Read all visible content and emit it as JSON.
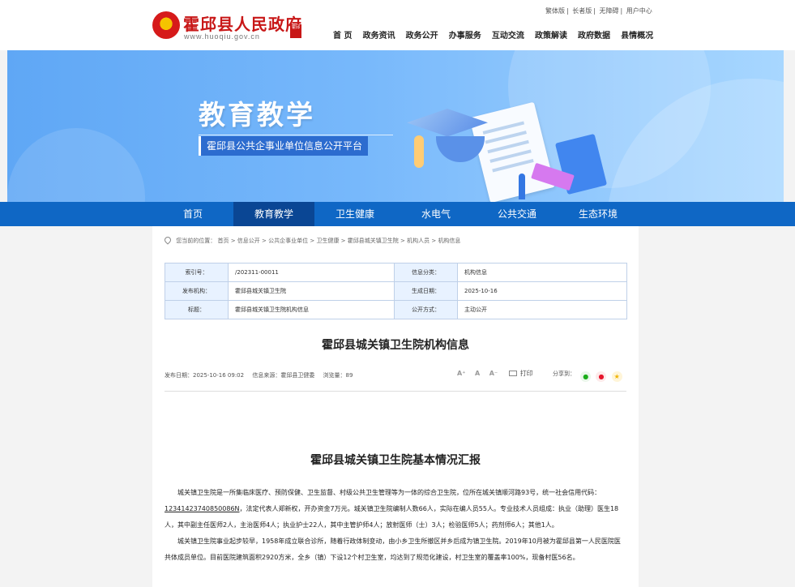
{
  "header": {
    "site_title": "霍邱县人民政府",
    "url_text": "www.huoqiu.gov.cn",
    "seal_text": "霍邱",
    "top_links": [
      "繁体版",
      "长者版",
      "无障碍",
      "用户中心"
    ],
    "nav": [
      "首 页",
      "政务资讯",
      "政务公开",
      "办事服务",
      "互动交流",
      "政策解读",
      "政府数据",
      "县情概况"
    ]
  },
  "banner": {
    "title": "教育教学",
    "subtitle": "霍邱县公共企事业单位信息公开平台"
  },
  "category_nav": {
    "items": [
      "首页",
      "教育教学",
      "卫生健康",
      "水电气",
      "公共交通",
      "生态环境"
    ],
    "active": "教育教学"
  },
  "breadcrumb": {
    "prefix": "您当前的位置：",
    "items": [
      "首页",
      "信息公开",
      "公共企事业单位",
      "卫生健康",
      "霍邱县城关镇卫生院",
      "机构人员",
      "机构信息"
    ]
  },
  "meta": {
    "rows": [
      [
        "索引号：",
        "/202311-00011",
        "信息分类：",
        "机构信息"
      ],
      [
        "发布机构：",
        "霍邱县城关镇卫生院",
        "生成日期：",
        "2025-10-16"
      ],
      [
        "标题：",
        "霍邱县城关镇卫生院机构信息",
        "公开方式：",
        "主动公开"
      ]
    ]
  },
  "article": {
    "title": "霍邱县城关镇卫生院机构信息",
    "publish_date": "发布日期：2025-10-16 09:02",
    "source": "信息来源：霍邱县卫健委",
    "views": "浏览量：89",
    "font_large": "A⁺",
    "font_medium": "A",
    "font_small": "A⁻",
    "print_label": "打印",
    "share_label": "分享到：",
    "section_title": "霍邱县城关镇卫生院基本情况汇报",
    "para1_before_code": "城关镇卫生院是一所集临床医疗、预防保健、卫生监督、村级公共卫生管理等为一体的综合卫生院，位所在城关镇顺河路93号，统一社会信用代码：",
    "credit_code": "12341423740850086N",
    "para1_after_code": "，法定代表人郑新权，开办资金7万元。城关镇卫生院编制人数66人，实际在编人员55人。专业技术人员组成：执业（助理）医生18人，其中副主任医师2人，主治医师4人；执业护士22人，其中主管护师4人；放射医师（士）3人；检验医师5人；药剂师6人；其他1人。",
    "para2": "城关镇卫生院事业起步较早，1958年成立联合诊所，随着行政体制变动，由小乡卫生所撤区并乡后成为镇卫生院。2019年10月被为霍邱县第一人民医院医共体成员单位。目前医院建筑面积2920方米，全乡（镇）下设12个村卫生室，均达到了规范化建设，村卫生室的覆盖率100%，现备村医56名。"
  },
  "colors": {
    "brand_red": "#c81717",
    "nav_blue": "#0f67c5",
    "nav_active": "#0a4694",
    "table_key_bg": "#e8f2ff"
  }
}
